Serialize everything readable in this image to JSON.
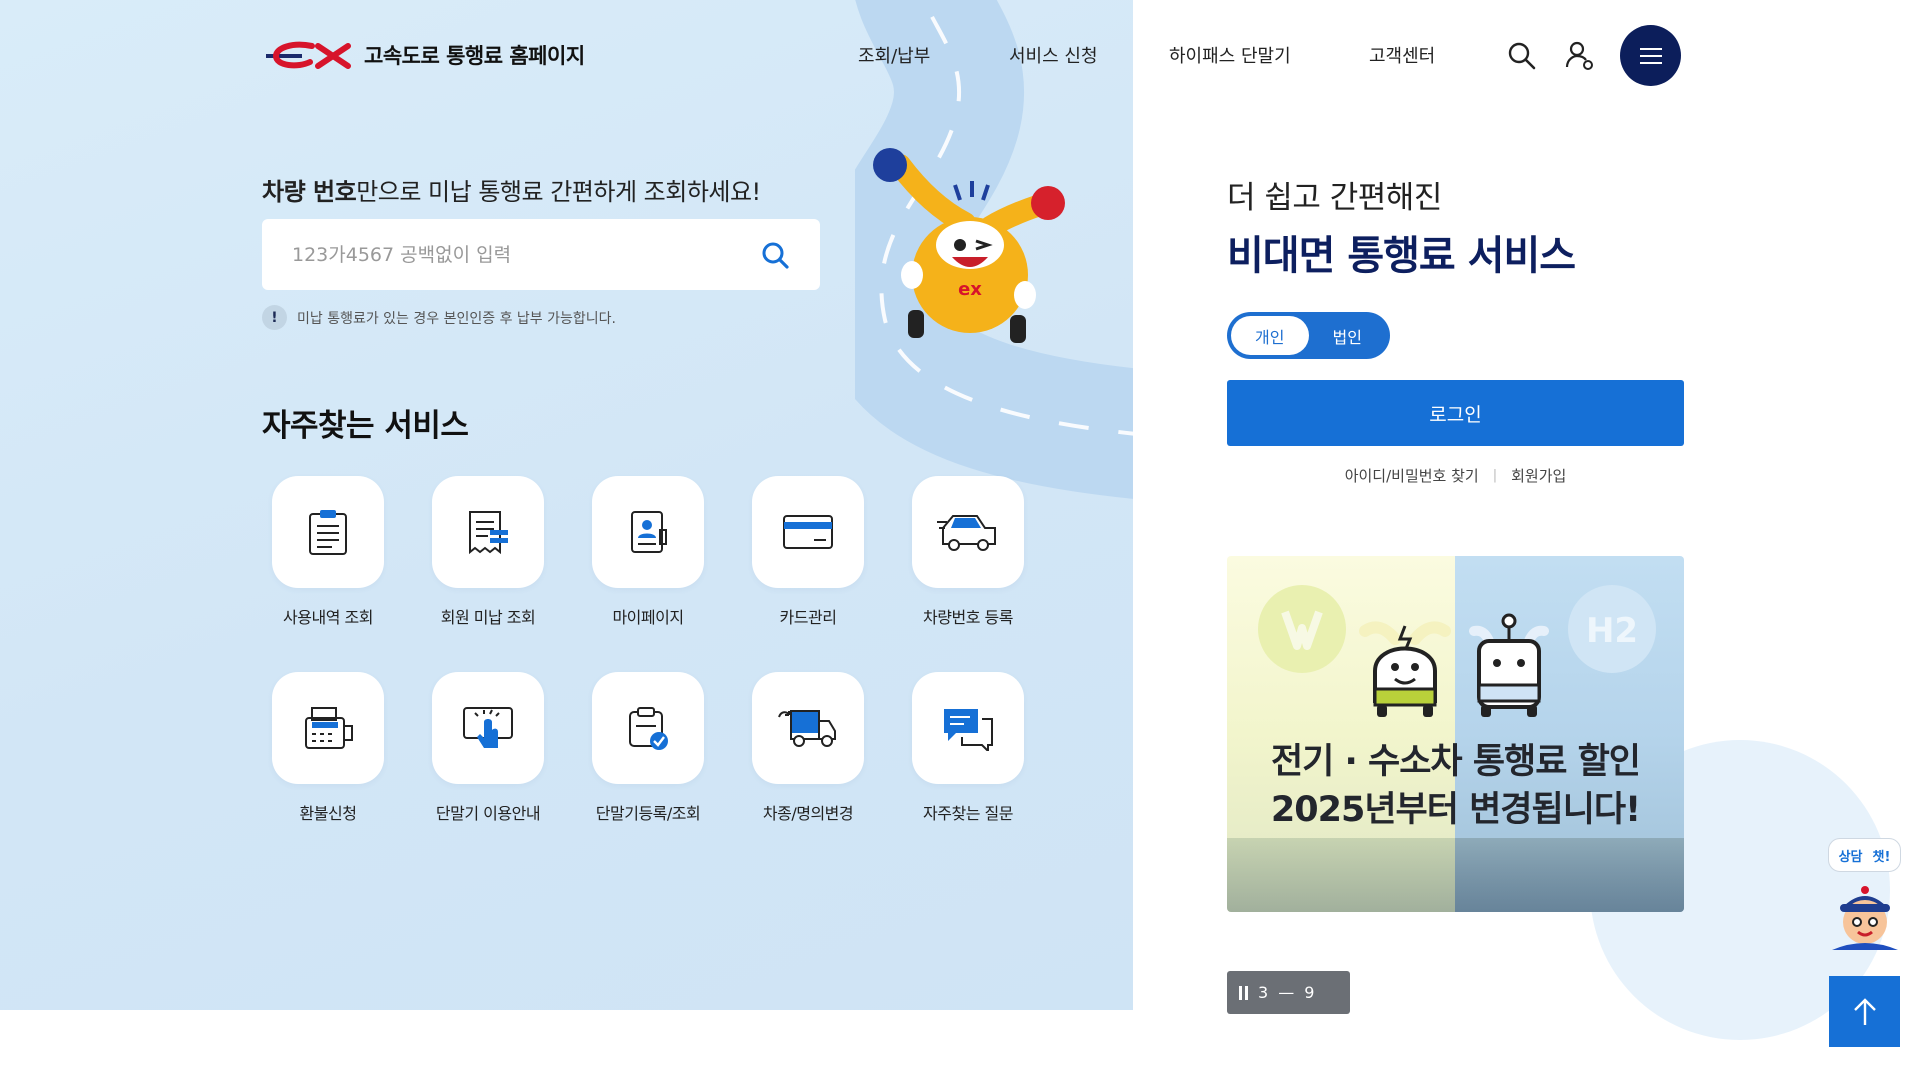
{
  "header": {
    "logo_text": "ex",
    "title": "고속도로 통행료 홈페이지",
    "nav": [
      "조회/납부",
      "서비스 신청",
      "하이패스 단말기",
      "고객센터"
    ],
    "icons": [
      "search-icon",
      "user-icon",
      "menu-icon"
    ]
  },
  "search": {
    "heading_bold": "차량 번호",
    "heading_rest": "만으로 미납 통행료 간편하게 조회하세요!",
    "placeholder": "123가4567 공백없이 입력",
    "note_icon": "!",
    "note": "미납 통행료가 있는 경우 본인인증 후 납부 가능합니다."
  },
  "services": {
    "title": "자주찾는 서비스",
    "items": [
      {
        "label": "사용내역 조회",
        "icon": "document-list-icon"
      },
      {
        "label": "회원 미납 조회",
        "icon": "receipt-icon"
      },
      {
        "label": "마이페이지",
        "icon": "profile-card-icon"
      },
      {
        "label": "카드관리",
        "icon": "credit-card-icon"
      },
      {
        "label": "차량번호 등록",
        "icon": "car-icon"
      },
      {
        "label": "환불신청",
        "icon": "refund-calculator-icon"
      },
      {
        "label": "단말기 이용안내",
        "icon": "touch-screen-icon"
      },
      {
        "label": "단말기등록/조회",
        "icon": "device-check-icon"
      },
      {
        "label": "차종/명의변경",
        "icon": "truck-change-icon"
      },
      {
        "label": "자주찾는 질문",
        "icon": "chat-faq-icon"
      }
    ]
  },
  "login": {
    "subtitle": "더 쉽고 간편해진",
    "title": "비대면 통행료 서비스",
    "toggle": [
      "개인",
      "법인"
    ],
    "login_button": "로그인",
    "links": [
      "아이디/비밀번호 찾기",
      "회원가입"
    ],
    "link_separator": "|"
  },
  "banner": {
    "line1": "전기 · 수소차 통행료 할인",
    "line2": "2025년부터 변경됩니다!",
    "badge_h2": "H2"
  },
  "slider": {
    "current": "3",
    "separator": "—",
    "total": "9"
  },
  "floating": {
    "chat_left": "상담",
    "chat_right": "챗!"
  },
  "colors": {
    "brand_navy": "#0c1e5b",
    "accent_blue": "#1670d6",
    "logo_red": "#d7142b"
  }
}
